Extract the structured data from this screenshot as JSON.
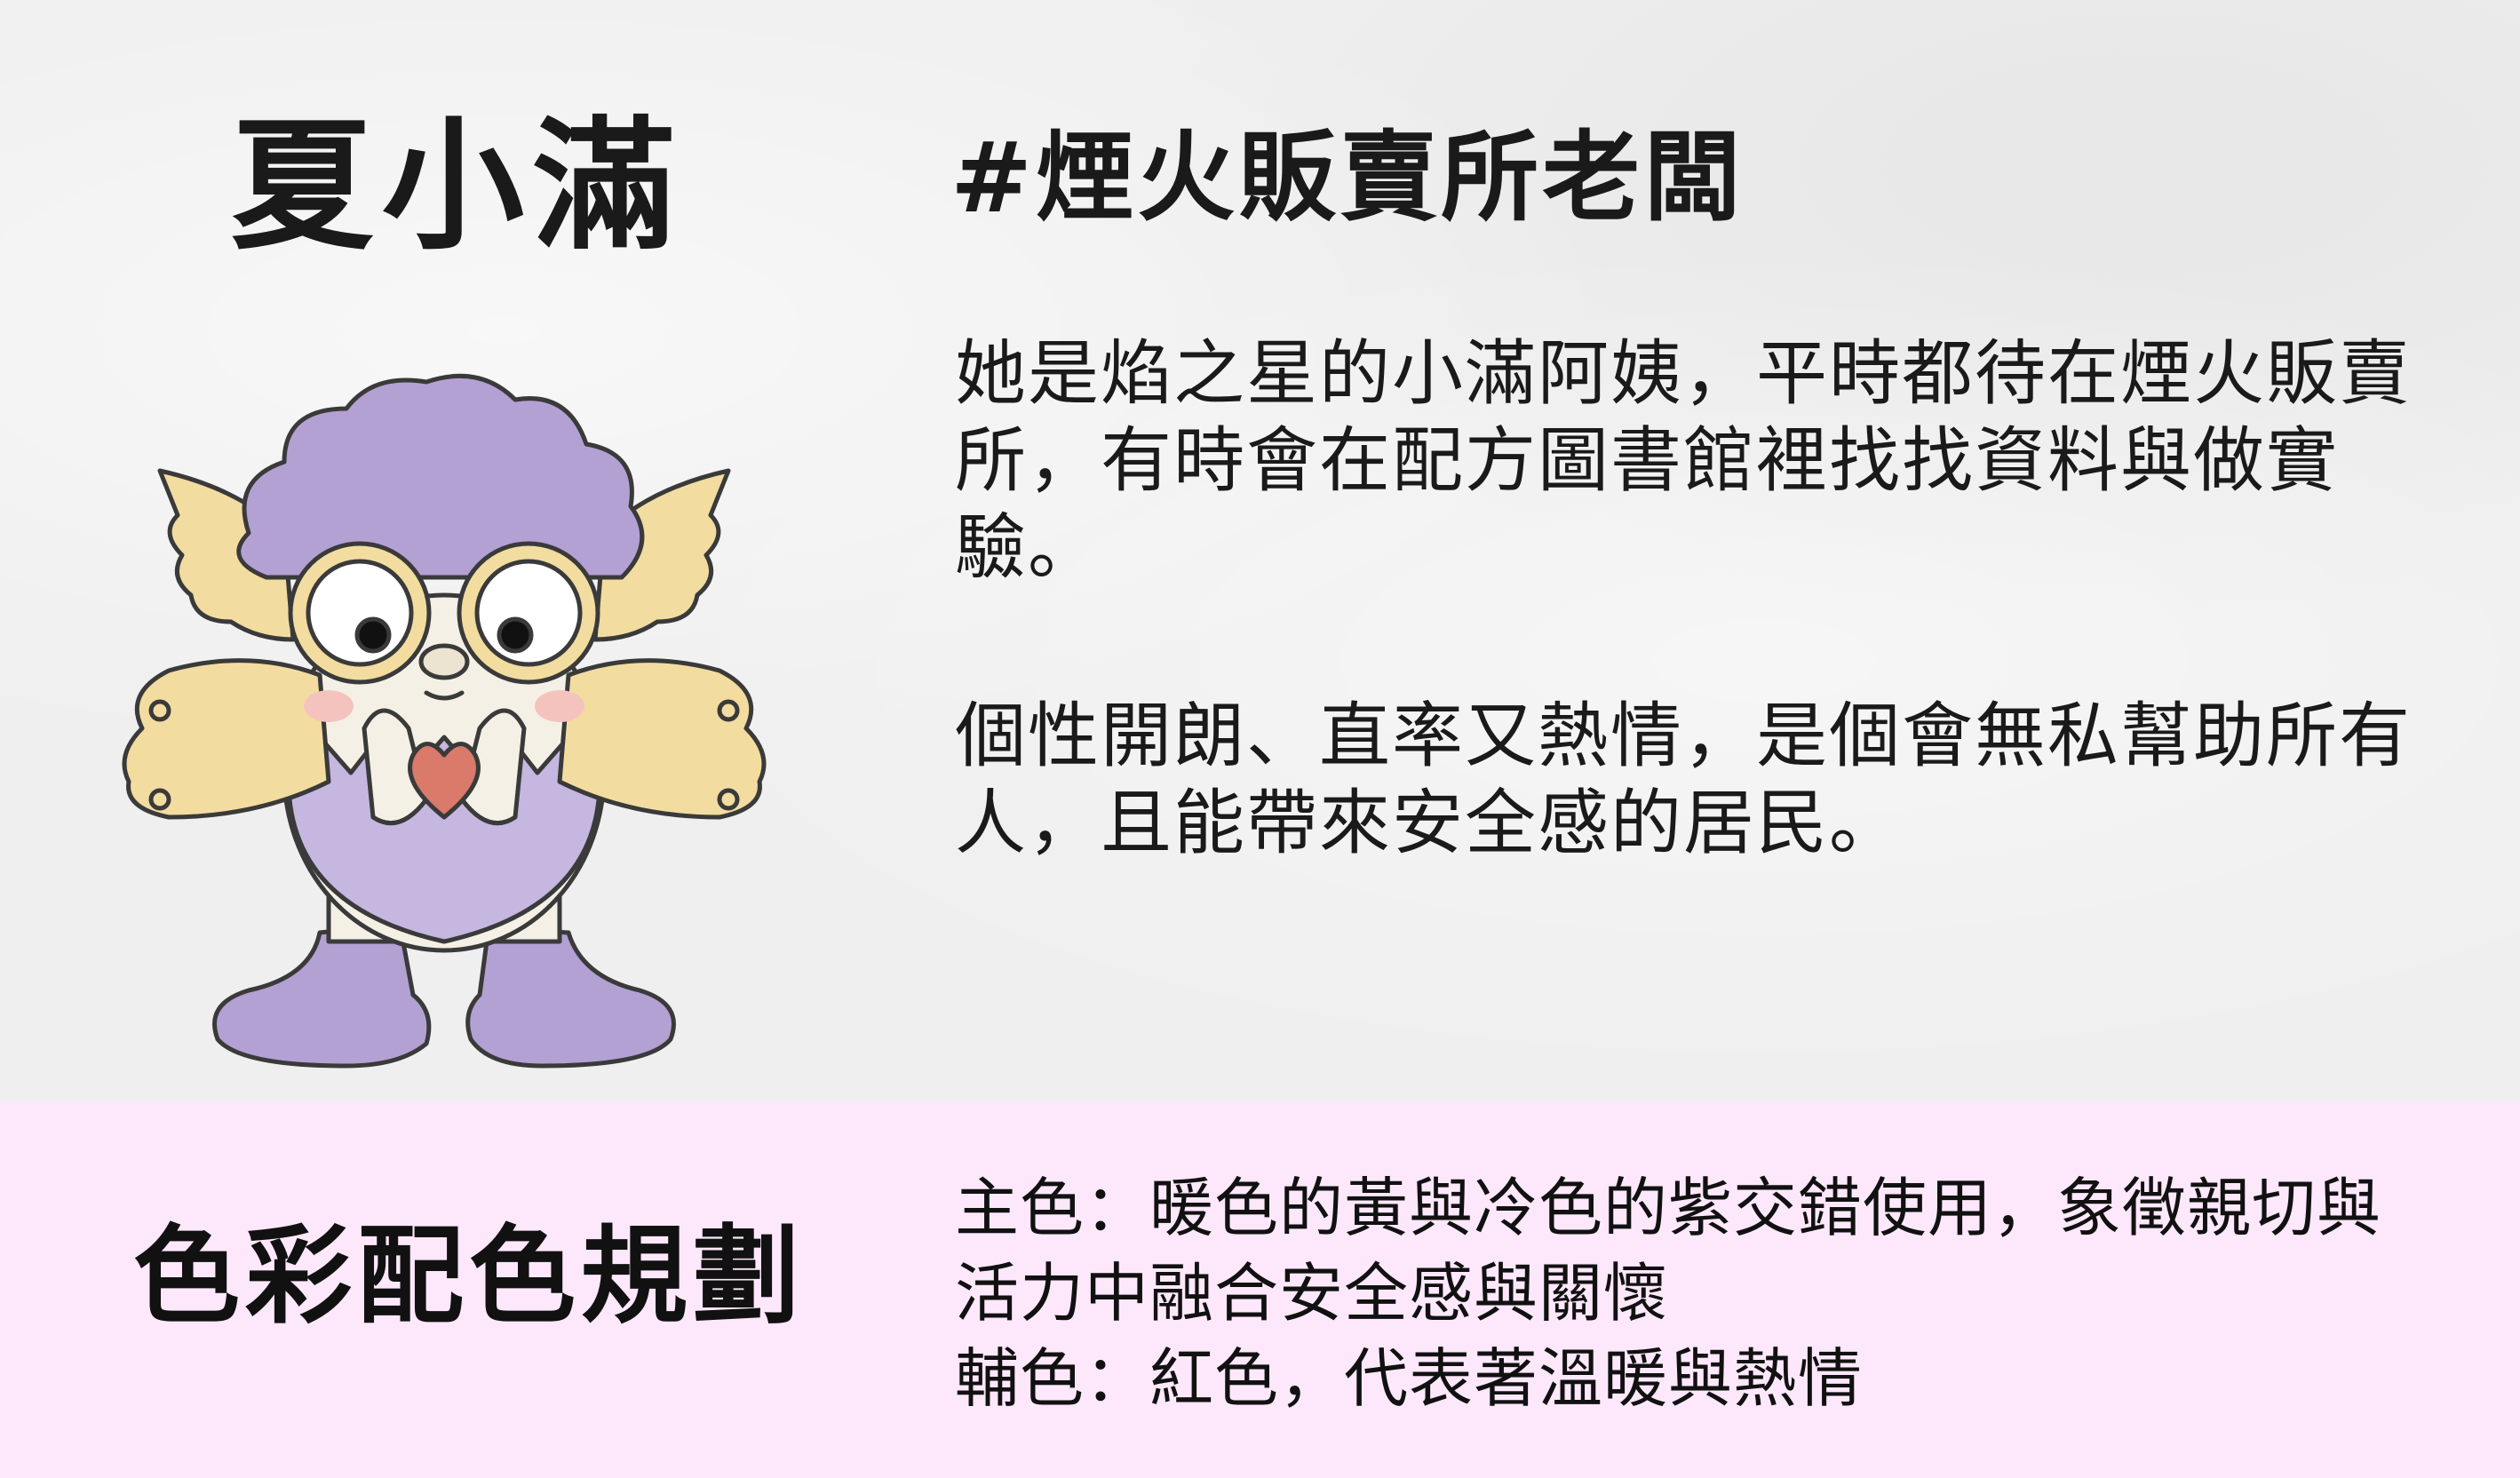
{
  "character": {
    "name": "夏小滿",
    "role": "#煙火販賣所老闆",
    "description": [
      "她是焰之星的小滿阿姨，平時都待在煙火販賣所，有時會在配方圖書館裡找找資料與做實驗。",
      "個性開朗、直率又熱情，是個會無私幫助所有人，且能帶來安全感的居民。"
    ]
  },
  "color_plan": {
    "heading": "色彩配色規劃",
    "primary": "主色：暖色的黃與冷色的紫交錯使用，象徵親切與活力中融合安全感與關懷",
    "secondary": "輔色：紅色，代表著溫暖與熱情"
  },
  "colors": {
    "background": "#efefef",
    "bottom_panel": "#fde8fb",
    "purple": "#b3a1d3",
    "yellow": "#f2dca0",
    "red": "#d97a6a",
    "text": "#111111"
  }
}
